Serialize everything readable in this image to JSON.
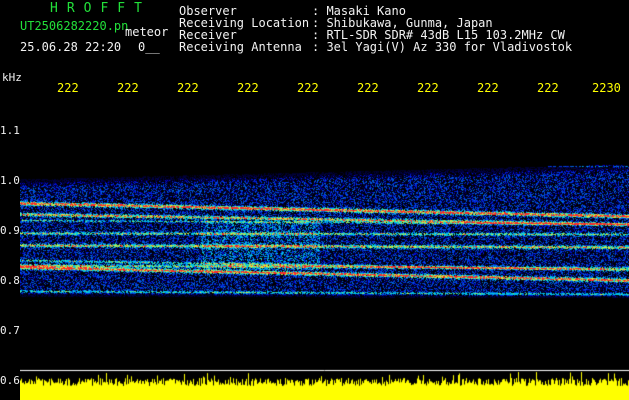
{
  "header": {
    "brand": "HROFFT",
    "filename": "UT2506282220.pn",
    "event_label": "meteor",
    "timestamp": "25.06.28 22:20",
    "counter": "0__",
    "fields": [
      {
        "label": "Observer",
        "value": ": Masaki Kano"
      },
      {
        "label": "Receiving Location",
        "value": ": Shibukawa, Gunma, Japan"
      },
      {
        "label": "Receiver",
        "value": ": RTL-SDR SDR# 43dB L15 103.2MHz CW"
      },
      {
        "label": "Receiving Antenna",
        "value": ": 3el Yagi(V) Az 330 for Vladivostok"
      }
    ]
  },
  "axes": {
    "y_unit": "kHz",
    "x_ticks": [
      "222",
      "222",
      "222",
      "222",
      "222",
      "222",
      "222",
      "222",
      "222",
      "2230"
    ],
    "y_ticks": [
      "1.1",
      "1.0",
      "0.9",
      "0.8",
      "0.7",
      "0.6"
    ]
  },
  "colors": {
    "header_green": "#22e03a",
    "header_white": "#f2f2f2",
    "tick_yellow": "#ffff00",
    "signal_floor": "#ffff00"
  }
}
